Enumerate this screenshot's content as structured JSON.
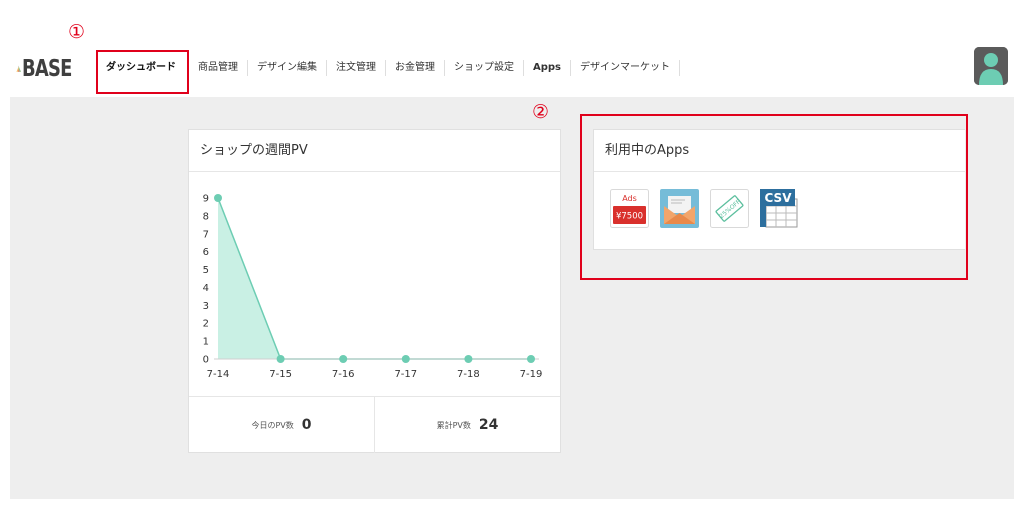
{
  "logo": {
    "text": "BASE"
  },
  "nav": {
    "items": [
      {
        "label": "ダッシュボード",
        "active": true
      },
      {
        "label": "商品管理"
      },
      {
        "label": "デザイン編集"
      },
      {
        "label": "注文管理"
      },
      {
        "label": "お金管理"
      },
      {
        "label": "ショップ設定"
      },
      {
        "label": "Apps"
      },
      {
        "label": "デザインマーケット"
      }
    ]
  },
  "annotations": {
    "first": "①",
    "second": "②"
  },
  "colors": {
    "accent": "#6dcdb3",
    "fill": "#c9f0e4",
    "annotation": "#e0001b"
  },
  "pv_card": {
    "title": "ショップの週間PV",
    "today_label": "今日のPV数",
    "today_value": "0",
    "total_label": "累計PV数",
    "total_value": "24"
  },
  "chart_data": {
    "type": "area",
    "x": [
      "7-14",
      "7-15",
      "7-16",
      "7-17",
      "7-18",
      "7-19"
    ],
    "values": [
      9,
      0,
      0,
      0,
      0,
      0
    ],
    "ylim": [
      0,
      9
    ],
    "yticks": [
      0,
      1,
      2,
      3,
      4,
      5,
      6,
      7,
      8,
      9
    ],
    "grid": false
  },
  "apps_card": {
    "title": "利用中のApps",
    "apps": [
      {
        "name": "ads-app",
        "icon": "ads-icon",
        "line1": "Ads",
        "line2": "¥7500"
      },
      {
        "name": "mail-app",
        "icon": "envelope-icon"
      },
      {
        "name": "coupon-app",
        "icon": "coupon-icon",
        "line1": "25%OFF"
      },
      {
        "name": "csv-app",
        "icon": "csv-icon",
        "line1": "CSV"
      }
    ]
  }
}
